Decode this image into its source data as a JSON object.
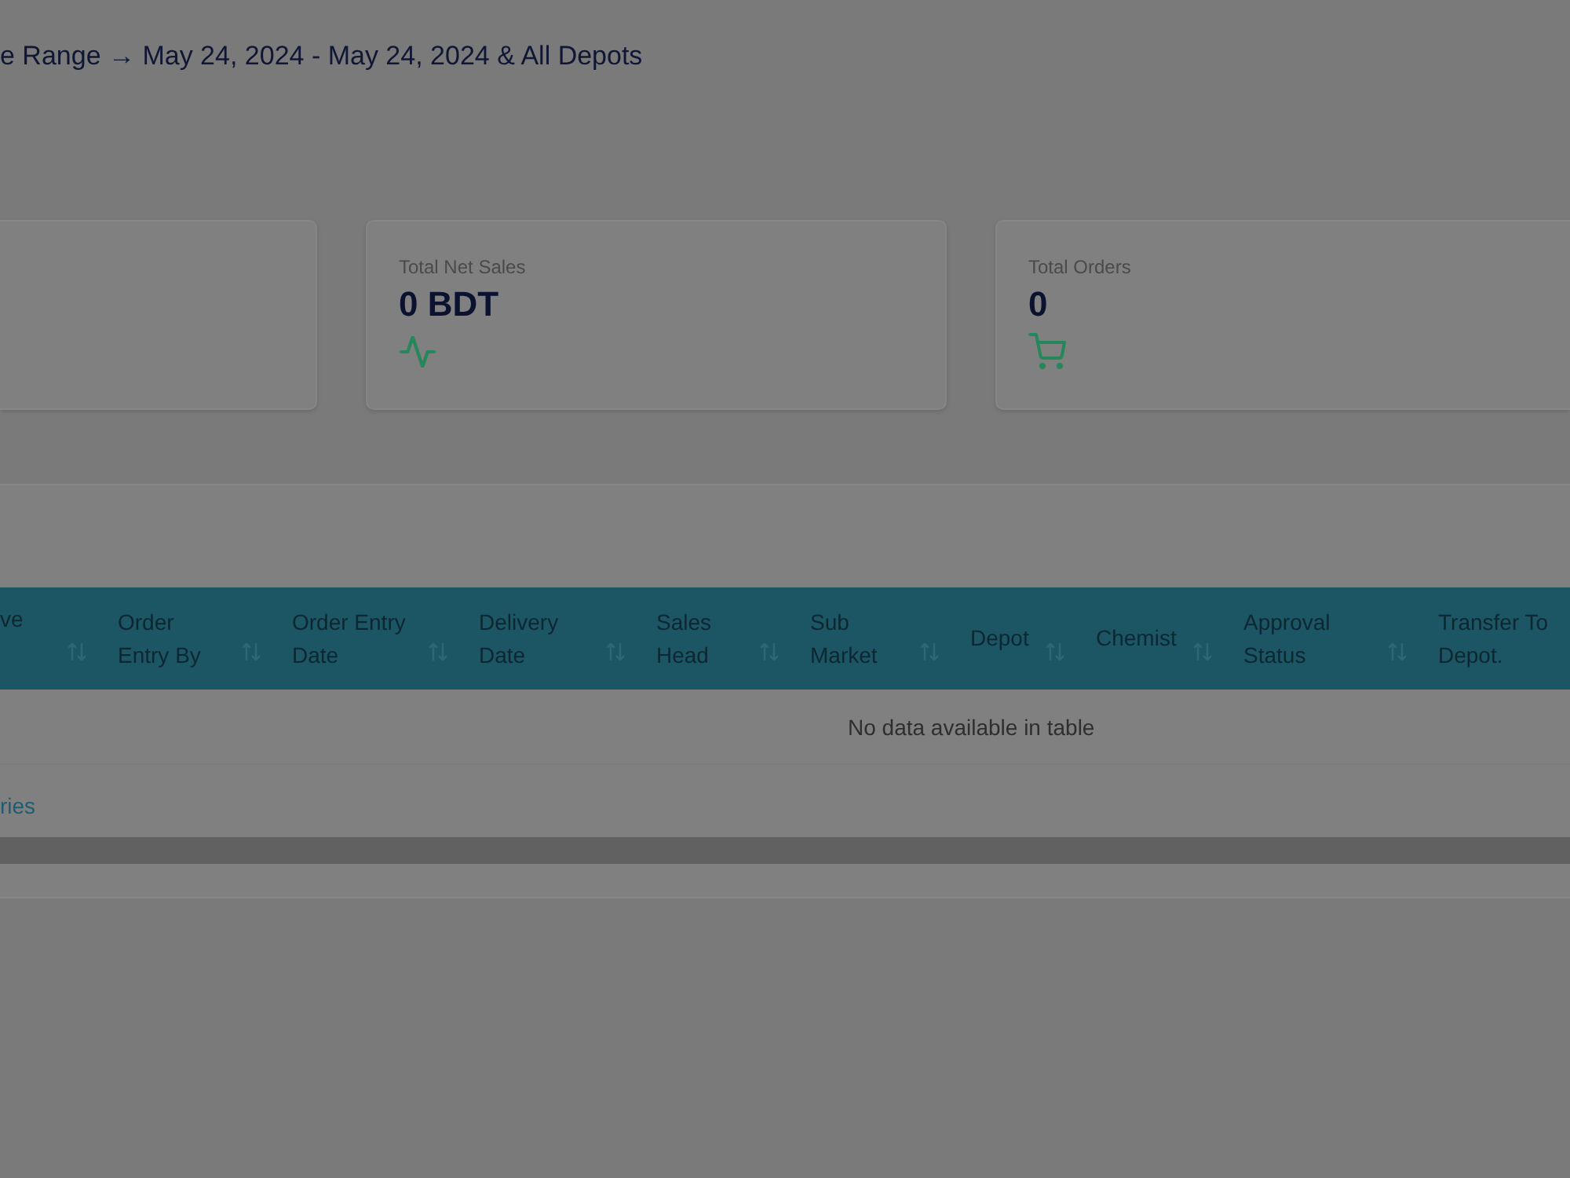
{
  "heading": "e Range → May 24, 2024 - May 24, 2024 & All Depots",
  "stat_cards": [
    {
      "kind": "blank"
    },
    {
      "kind": "sales",
      "label": "Total Net Sales",
      "value": "0 BDT"
    },
    {
      "kind": "orders",
      "label": "Total Orders",
      "value": "0"
    }
  ],
  "table": {
    "columns": [
      {
        "label": "ve",
        "sortable": true
      },
      {
        "label": "Order Entry By",
        "sortable": true
      },
      {
        "label": "Order Entry Date",
        "sortable": true
      },
      {
        "label": "Delivery Date",
        "sortable": true
      },
      {
        "label": "Sales Head",
        "sortable": true
      },
      {
        "label": "Sub Market",
        "sortable": true
      },
      {
        "label": "Depot",
        "sortable": true
      },
      {
        "label": "Chemist",
        "sortable": true
      },
      {
        "label": "Approval Status",
        "sortable": true
      },
      {
        "label": "Transfer To Depot.",
        "sortable": false
      }
    ],
    "empty_message": "No data available in table",
    "info": "ries"
  }
}
